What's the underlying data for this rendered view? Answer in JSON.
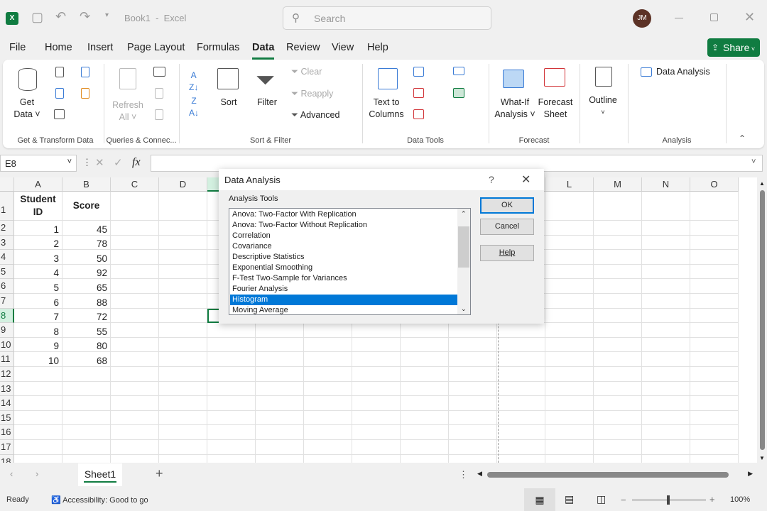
{
  "titlebar": {
    "doc_title": "Book1  -  Excel",
    "search_placeholder": "Search",
    "avatar": "JM"
  },
  "tabs": [
    "File",
    "Home",
    "Insert",
    "Page Layout",
    "Formulas",
    "Data",
    "Review",
    "View",
    "Help"
  ],
  "active_tab": "Data",
  "share": "Share",
  "ribbon": {
    "get_data": [
      "Get",
      "Data ˅"
    ],
    "refresh": [
      "Refresh",
      "All ˅"
    ],
    "sort": "Sort",
    "filter": "Filter",
    "clear": "Clear",
    "reapply": "Reapply",
    "advanced": "Advanced",
    "text_to_columns": [
      "Text to",
      "Columns"
    ],
    "what_if": [
      "What-If",
      "Analysis ˅"
    ],
    "forecast_sheet": [
      "Forecast",
      "Sheet"
    ],
    "outline": "Outline",
    "data_analysis": "Data Analysis",
    "groups": [
      "Get & Transform Data",
      "Queries & Connec...",
      "Sort & Filter",
      "Data Tools",
      "Forecast",
      "Analysis"
    ]
  },
  "formula_bar": {
    "name_box": "E8",
    "fx": "fx",
    "value": ""
  },
  "columns": [
    "A",
    "B",
    "C",
    "D",
    "E",
    "F",
    "G",
    "H",
    "I",
    "J",
    "K",
    "L",
    "M",
    "N",
    "O"
  ],
  "rows": [
    "1",
    "2",
    "3",
    "4",
    "5",
    "6",
    "7",
    "8",
    "9",
    "10",
    "11",
    "12",
    "13",
    "14",
    "15",
    "16",
    "17",
    "18"
  ],
  "headers": [
    "Student ID",
    "Score"
  ],
  "data": [
    [
      1,
      45
    ],
    [
      2,
      78
    ],
    [
      3,
      50
    ],
    [
      4,
      92
    ],
    [
      5,
      65
    ],
    [
      6,
      88
    ],
    [
      7,
      72
    ],
    [
      8,
      55
    ],
    [
      9,
      80
    ],
    [
      10,
      68
    ]
  ],
  "selected_cell": "E8",
  "dialog": {
    "title": "Data Analysis",
    "help_glyph": "?",
    "label": "Analysis Tools",
    "items": [
      "Anova: Two-Factor With Replication",
      "Anova: Two-Factor Without Replication",
      "Correlation",
      "Covariance",
      "Descriptive Statistics",
      "Exponential Smoothing",
      "F-Test Two-Sample for Variances",
      "Fourier Analysis",
      "Histogram",
      "Moving Average"
    ],
    "selected": "Histogram",
    "ok": "OK",
    "cancel": "Cancel",
    "help": "Help"
  },
  "sheet_tabs": {
    "active": "Sheet1"
  },
  "status": {
    "ready": "Ready",
    "accessibility": "Accessibility: Good to go",
    "zoom": "100%"
  },
  "colors": {
    "accent": "#107c41",
    "selection": "#0078d7"
  }
}
